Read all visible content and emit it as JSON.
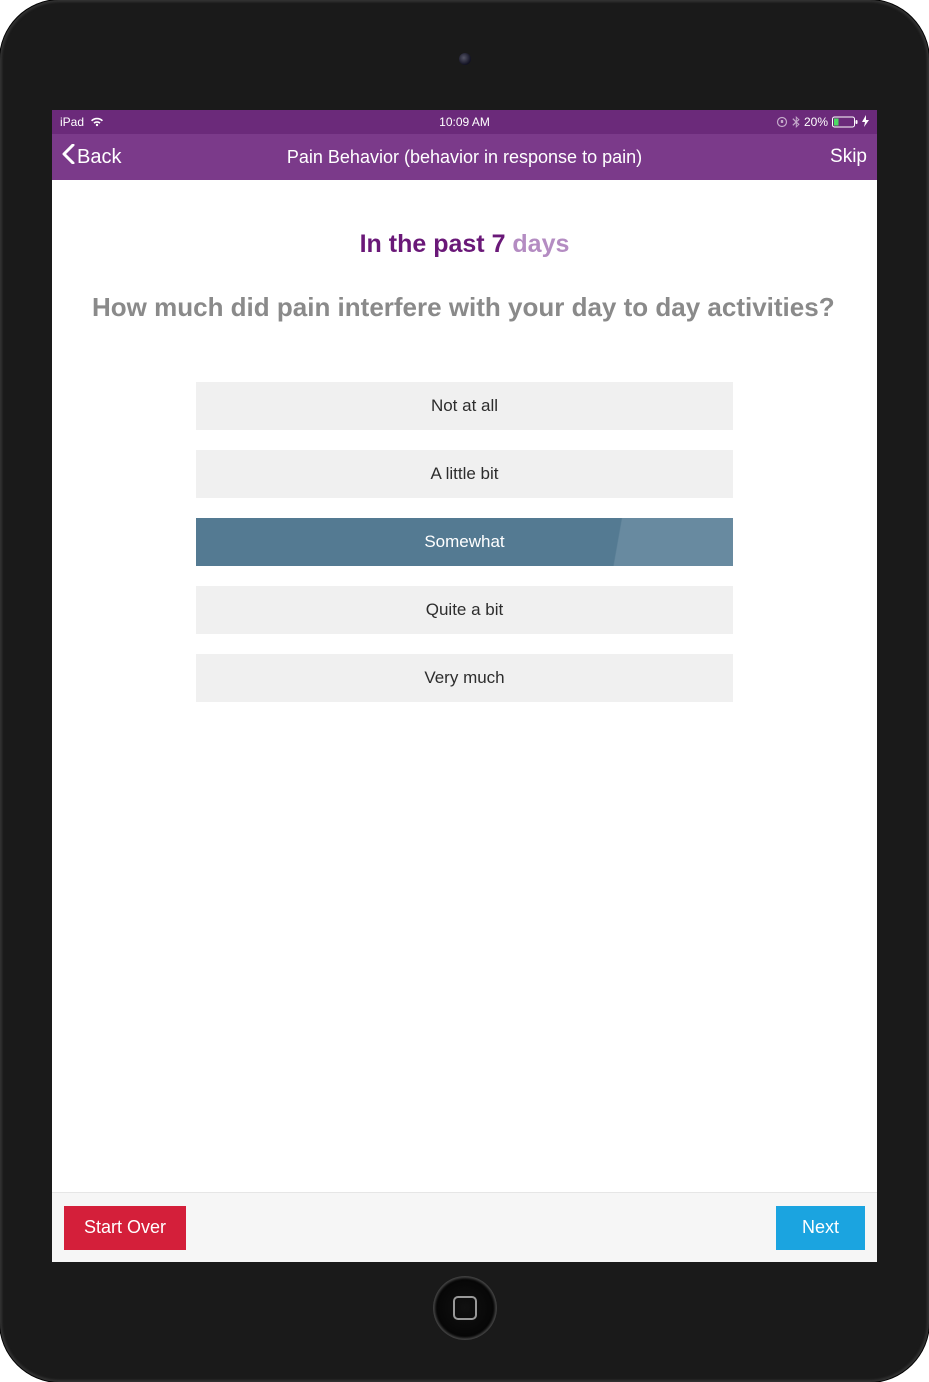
{
  "status_bar": {
    "device_label": "iPad",
    "time": "10:09 AM",
    "battery_percent": "20%"
  },
  "nav": {
    "back_label": "Back",
    "title": "Pain Behavior (behavior in response to pain)",
    "skip_label": "Skip"
  },
  "prompt": {
    "prefix": "In the past ",
    "count": "7",
    "suffix": " days"
  },
  "question": "How much did pain interfere with your day to day activities?",
  "options": [
    {
      "label": "Not at all",
      "selected": false
    },
    {
      "label": "A little bit",
      "selected": false
    },
    {
      "label": "Somewhat",
      "selected": true
    },
    {
      "label": "Quite a bit",
      "selected": false
    },
    {
      "label": "Very much",
      "selected": false
    }
  ],
  "footer": {
    "start_over_label": "Start Over",
    "next_label": "Next"
  },
  "colors": {
    "nav_purple": "#7b3a8a",
    "status_purple": "#6b2a7a",
    "selected_blue": "#557a92",
    "start_over_red": "#d41f3a",
    "next_blue": "#1ba4e0"
  }
}
